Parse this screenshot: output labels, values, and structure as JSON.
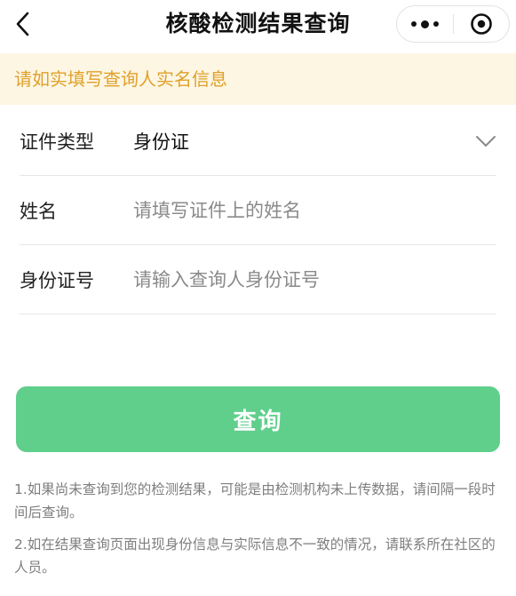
{
  "navbar": {
    "title": "核酸检测结果查询"
  },
  "notice": "请如实填写查询人实名信息",
  "form": {
    "id_type": {
      "label": "证件类型",
      "value": "身份证"
    },
    "name": {
      "label": "姓名",
      "placeholder": "请填写证件上的姓名"
    },
    "id_number": {
      "label": "身份证号",
      "placeholder": "请输入查询人身份证号"
    }
  },
  "submit_label": "查询",
  "tips": [
    "1.如果尚未查询到您的检测结果，可能是由检测机构未上传数据，请间隔一段时间后查询。",
    "2.如在结果查询页面出现身份信息与实际信息不一致的情况，请联系所在社区的人员。"
  ],
  "colors": {
    "accent": "#5fcf8b",
    "notice_bg": "#fdf6e3",
    "notice_text": "#e0a02a"
  }
}
